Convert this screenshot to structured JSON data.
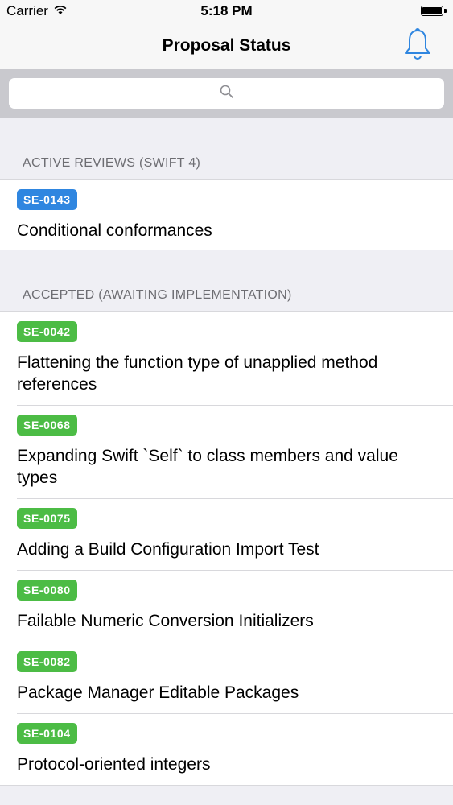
{
  "status_bar": {
    "carrier": "Carrier",
    "time": "5:18 PM"
  },
  "nav": {
    "title": "Proposal Status",
    "bell_icon": "bell-icon"
  },
  "search": {
    "icon": "search-icon",
    "placeholder": ""
  },
  "colors": {
    "tint": "#2f86e0",
    "active_badge": "#2f86e0",
    "accepted_badge": "#4cbc45"
  },
  "sections": [
    {
      "header": "ACTIVE REVIEWS (SWIFT 4)",
      "items": [
        {
          "id": "SE-0143",
          "title": "Conditional conformances"
        }
      ]
    },
    {
      "header": "ACCEPTED (AWAITING IMPLEMENTATION)",
      "items": [
        {
          "id": "SE-0042",
          "title": "Flattening the function type of unapplied method references"
        },
        {
          "id": "SE-0068",
          "title": "Expanding Swift `Self` to class members and value types"
        },
        {
          "id": "SE-0075",
          "title": "Adding a Build Configuration Import Test"
        },
        {
          "id": "SE-0080",
          "title": "Failable Numeric Conversion Initializers"
        },
        {
          "id": "SE-0082",
          "title": "Package Manager Editable Packages"
        },
        {
          "id": "SE-0104",
          "title": "Protocol-oriented integers"
        }
      ]
    }
  ]
}
